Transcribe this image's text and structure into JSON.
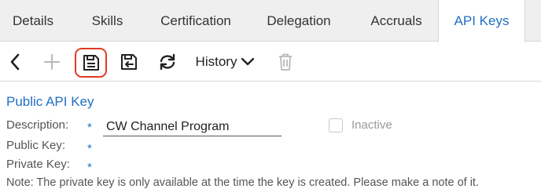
{
  "tabs": [
    {
      "label": "Details"
    },
    {
      "label": "Skills"
    },
    {
      "label": "Certification"
    },
    {
      "label": "Delegation"
    },
    {
      "label": "Accruals"
    },
    {
      "label": "API Keys"
    }
  ],
  "active_tab": "API Keys",
  "toolbar": {
    "back_icon": "chevron-left-icon",
    "add_icon": "plus-icon",
    "save_icon": "floppy-disk-icon",
    "save_return_icon": "floppy-disk-arrow-icon",
    "refresh_icon": "refresh-icon",
    "history_label": "History",
    "history_icon": "chevron-down-icon",
    "delete_icon": "trash-icon"
  },
  "form": {
    "title": "Public API Key",
    "description_label": "Description:",
    "description_value": "CW Channel Program",
    "public_key_label": "Public Key:",
    "private_key_label": "Private Key:",
    "required_marker": "*",
    "inactive_label": "Inactive",
    "inactive_checked": false,
    "note": "Note: The private key is only available at the time the key is created. Please make a note of it."
  },
  "colors": {
    "accent": "#1f6fc5",
    "highlight": "#e03b24",
    "tab_bar": "#efefef"
  }
}
